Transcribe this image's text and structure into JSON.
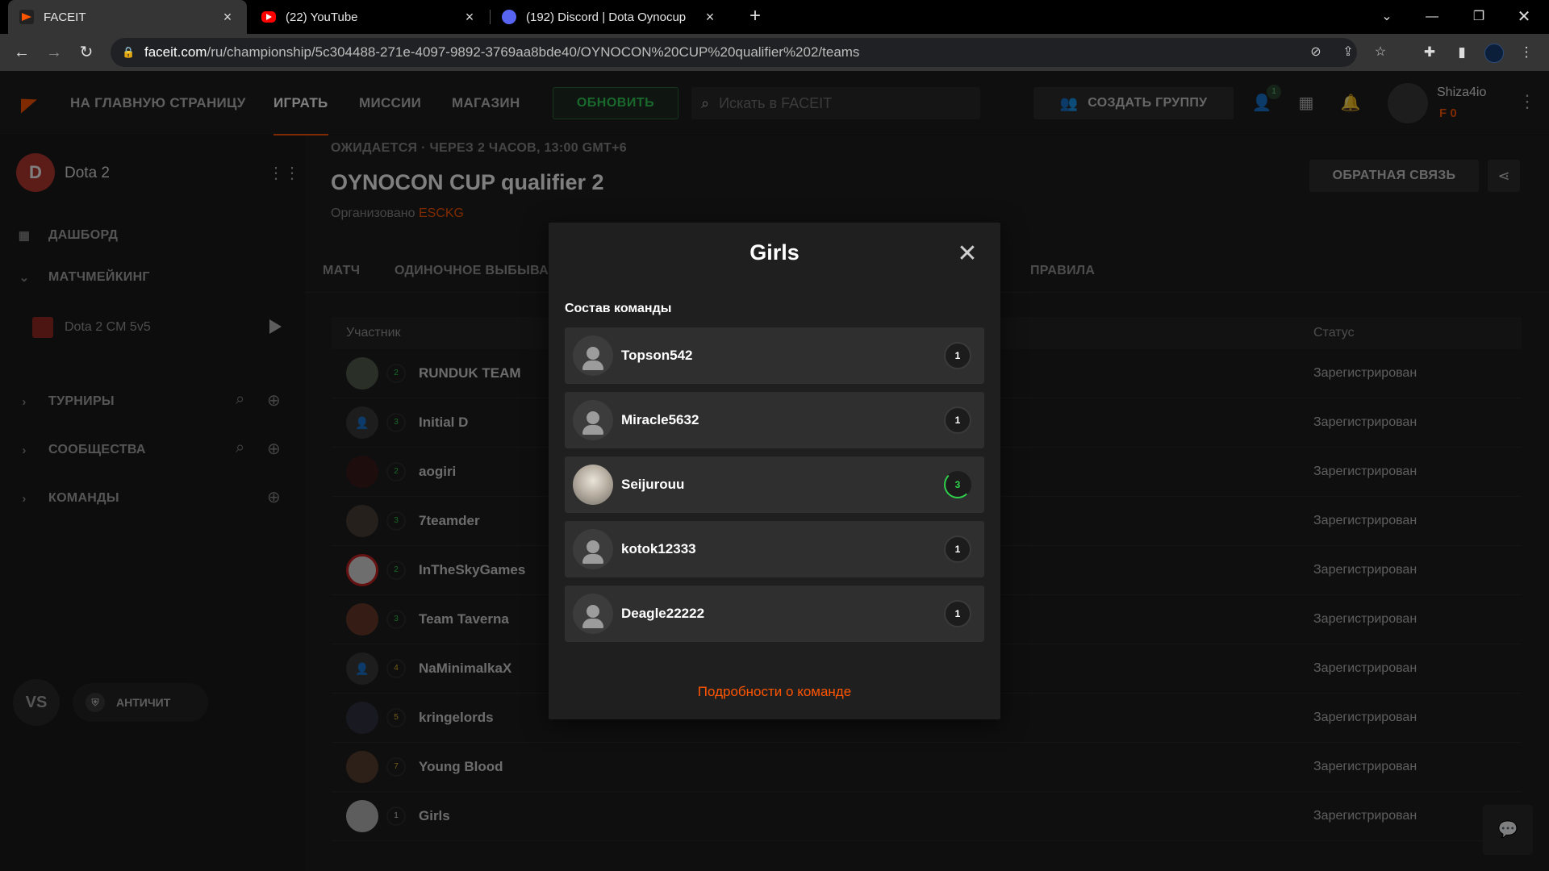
{
  "browser": {
    "tabs": [
      {
        "title": "FACEIT",
        "active": true
      },
      {
        "title": "(22) YouTube",
        "active": false
      },
      {
        "title": "(192) Discord | Dota Oynocup",
        "active": false
      }
    ],
    "url_host": "faceit.com",
    "url_path": "/ru/championship/5c304488-271e-4097-9892-3769aa8bde40/OYNOCON%20CUP%20qualifier%202/teams"
  },
  "topnav": {
    "links": [
      "НА ГЛАВНУЮ СТРАНИЦУ",
      "ИГРАТЬ",
      "МИССИИ",
      "МАГАЗИН"
    ],
    "active_link": "ИГРАТЬ",
    "update_label": "ОБНОВИТЬ",
    "search_placeholder": "Искать в FACEIT",
    "create_group_label": "СОЗДАТЬ ГРУППУ",
    "friends_badge": "1",
    "username": "Shiza4io",
    "points": "0"
  },
  "sidebar": {
    "game": "Dota 2",
    "items": {
      "dashboard": "ДАШБОРД",
      "matchmaking": "МАТЧМЕЙКИНГ",
      "queue": "Dota 2 CM 5v5",
      "tournaments": "ТУРНИРЫ",
      "communities": "СООБЩЕСТВА",
      "teams": "КОМАНДЫ"
    },
    "vs_label": "VS",
    "anticheat_label": "АНТИЧИТ"
  },
  "championship": {
    "status": "ОЖИДАЕТСЯ · ЧЕРЕЗ 2 ЧАСОВ, 13:00 GMT+6",
    "title": "OYNOCON CUP qualifier 2",
    "organized_by_label": "Организовано",
    "organizer": "ESCKG",
    "feedback_label": "ОБРАТНАЯ СВЯЗЬ",
    "tabs": [
      "МАТЧ",
      "ОДИНОЧНОЕ ВЫБЫВА",
      "ПРАВИЛА"
    ]
  },
  "table": {
    "col_participant": "Участник",
    "col_status": "Статус",
    "rows": [
      {
        "name": "RUNDUK TEAM",
        "level": "2",
        "status": "Зарегистрирован"
      },
      {
        "name": "Initial D",
        "level": "3",
        "status": "Зарегистрирован"
      },
      {
        "name": "aogiri",
        "level": "2",
        "status": "Зарегистрирован"
      },
      {
        "name": "7teamder",
        "level": "3",
        "status": "Зарегистрирован"
      },
      {
        "name": "InTheSkyGames",
        "level": "2",
        "status": "Зарегистрирован"
      },
      {
        "name": "Team Taverna",
        "level": "3",
        "status": "Зарегистрирован"
      },
      {
        "name": "NaMinimalkaX",
        "level": "4",
        "status": "Зарегистрирован"
      },
      {
        "name": "kringelords",
        "level": "5",
        "status": "Зарегистрирован"
      },
      {
        "name": "Young Blood",
        "level": "7",
        "status": "Зарегистрирован"
      },
      {
        "name": "Girls",
        "level": "1",
        "status": "Зарегистрирован"
      }
    ]
  },
  "modal": {
    "title": "Girls",
    "roster_label": "Состав команды",
    "players": [
      {
        "name": "Topson542",
        "level": "1"
      },
      {
        "name": "Miracle5632",
        "level": "1"
      },
      {
        "name": "Seijurouu",
        "level": "3"
      },
      {
        "name": "kotok12333",
        "level": "1"
      },
      {
        "name": "Deagle22222",
        "level": "1"
      }
    ],
    "details_link": "Подробности о команде"
  },
  "colors": {
    "accent": "#ff5500",
    "update_green": "#32d35a",
    "level_green": "#2fd14b"
  }
}
